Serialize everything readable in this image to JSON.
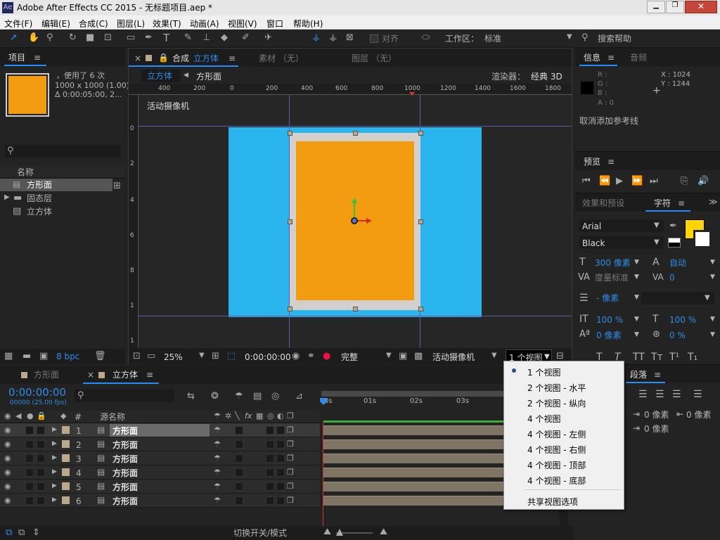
{
  "title": "Adobe After Effects CC 2015 - 无标题项目.aep *",
  "menu": [
    "文件(F)",
    "编辑(E)",
    "合成(C)",
    "图层(L)",
    "效果(T)",
    "动画(A)",
    "视图(V)",
    "窗口",
    "帮助(H)"
  ],
  "toolbar": {
    "snap": "对齐",
    "workspace_label": "工作区：",
    "workspace": "标准",
    "search": "搜索帮助"
  },
  "project": {
    "tab": "项目",
    "info1": "，使用了 6 次",
    "info2": "1000 x 1000 (1.00)",
    "info3": "Δ 0:00:05:00, 2...",
    "col_name": "名称",
    "items": [
      "方形面",
      "固态层",
      "立方体"
    ],
    "bpc": "8 bpc",
    "swatch": "#f39c12"
  },
  "comp": {
    "tab": "合成",
    "tab_name": "立方体",
    "footage": "素材 （无）",
    "layer": "图层 （无）",
    "crumb1": "立方体",
    "crumb2": "方形面",
    "renderer_label": "渲染器：",
    "renderer": "经典 3D",
    "camera_label": "活动摄像机",
    "ruler": [
      "400",
      "200",
      "0",
      "200",
      "400",
      "600",
      "800",
      "1000",
      "1200",
      "1400",
      "1600",
      "1800"
    ],
    "vruler": [
      "0",
      "2",
      "4",
      "6",
      "8",
      "1",
      "1"
    ],
    "zoom": "25%",
    "time": "0:00:00:00",
    "quality": "完整",
    "camera": "活动摄像机",
    "views": "1 个视图",
    "bg": "#2bb5ee",
    "solid": "#f39c12"
  },
  "info": {
    "tab": "信息",
    "audio": "音频",
    "r": "R :",
    "g": "G :",
    "b": "B :",
    "a": "A : 0",
    "x": "X : 1024",
    "y": "Y : 1244",
    "msg": "取消添加参考线"
  },
  "preview": {
    "tab": "预览"
  },
  "character": {
    "tab_effects": "效果和预设",
    "tab_char": "字符",
    "font": "Arial",
    "style": "Black",
    "size": "300 像素",
    "leading": "自动",
    "kern": "度量标准",
    "track": "0",
    "stroke": "- 像素",
    "vscale": "100 %",
    "hscale": "100 %",
    "baseline": "0 像素",
    "tsume": "0 %",
    "fill": "#ffd400"
  },
  "paragraph": {
    "tab": "段落",
    "indent1": "0 像素",
    "indent2": "0 像素",
    "indent3": "0 像素"
  },
  "timeline": {
    "tab1": "方形面",
    "tab2": "立方体",
    "time": "0:00:00:00",
    "fps": "00000 (25.00 fps)",
    "col_source": "源名称",
    "ticks": [
      "0s",
      "01s",
      "02s",
      "03s"
    ],
    "layers": [
      {
        "n": "1",
        "name": "方形面"
      },
      {
        "n": "2",
        "name": "方形面"
      },
      {
        "n": "3",
        "name": "方形面"
      },
      {
        "n": "4",
        "name": "方形面"
      },
      {
        "n": "5",
        "name": "方形面"
      },
      {
        "n": "6",
        "name": "方形面"
      }
    ],
    "switch": "切换开关/模式"
  },
  "view_menu": {
    "items": [
      "1 个视图",
      "2 个视图 - 水平",
      "2 个视图 - 纵向",
      "4 个视图",
      "4 个视图 - 左侧",
      "4 个视图 - 右侧",
      "4 个视图 - 顶部",
      "4 个视图 - 底部"
    ],
    "shared": "共享视图选项",
    "selected": "1 个视图"
  }
}
